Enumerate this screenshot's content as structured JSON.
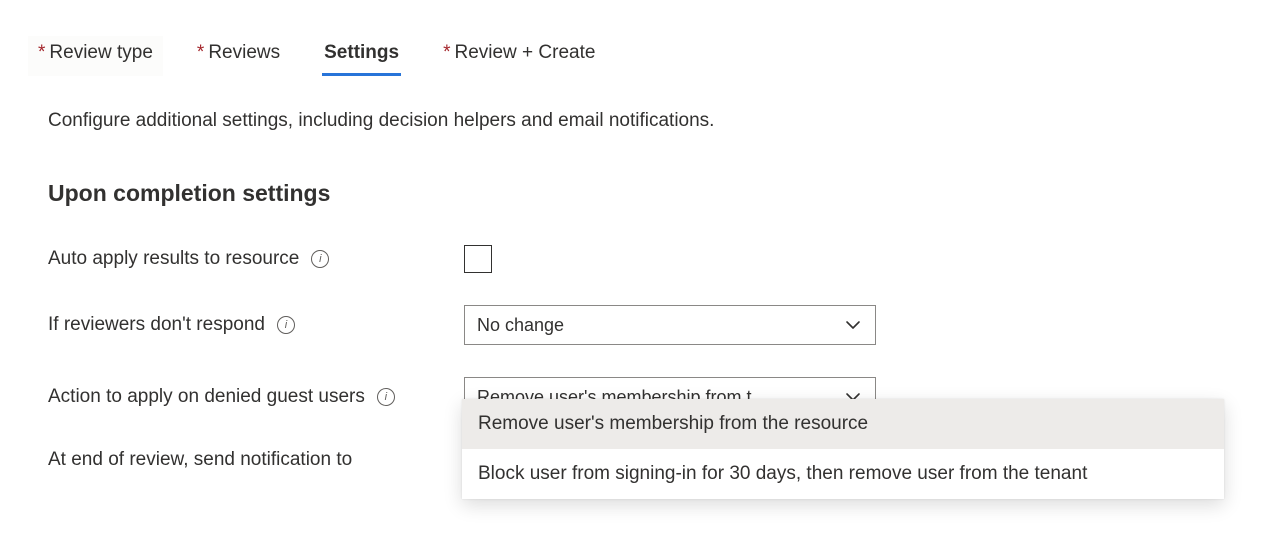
{
  "tabs": {
    "reviewType": "Review type",
    "reviews": "Reviews",
    "settings": "Settings",
    "reviewCreate": "Review + Create"
  },
  "description": "Configure additional settings, including decision helpers and email notifications.",
  "sectionHeading": "Upon completion settings",
  "form": {
    "autoApplyResults": {
      "label": "Auto apply results to resource"
    },
    "ifReviewers": {
      "label": "If reviewers don't respond",
      "value": "No change"
    },
    "deniedGuestAction": {
      "label": "Action to apply on denied guest users",
      "value": "Remove user's membership from t...",
      "options": [
        "Remove user's membership from the resource",
        "Block user from signing-in for 30 days, then remove user from the tenant"
      ]
    },
    "notificationTo": {
      "label": "At end of review, send notification to"
    }
  }
}
